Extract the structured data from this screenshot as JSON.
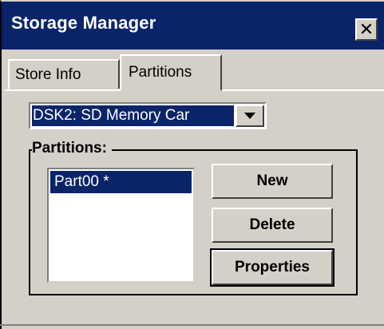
{
  "window": {
    "title": "Storage Manager",
    "close_glyph": "✕"
  },
  "tabs": [
    {
      "label": "Store Info",
      "selected": false
    },
    {
      "label": "Partitions",
      "selected": true
    }
  ],
  "store_select": {
    "value": "DSK2: SD Memory Car"
  },
  "partitions_group": {
    "label": "Partitions:",
    "items": [
      {
        "label": "Part00 *",
        "selected": true
      }
    ]
  },
  "buttons": {
    "new": "New",
    "delete": "Delete",
    "properties": "Properties"
  },
  "colors": {
    "title_bar": "#0a246a",
    "selection": "#0a246a",
    "face": "#d4d0c8"
  },
  "icons": {
    "close": "close-icon",
    "dropdown": "chevron-down-icon"
  }
}
